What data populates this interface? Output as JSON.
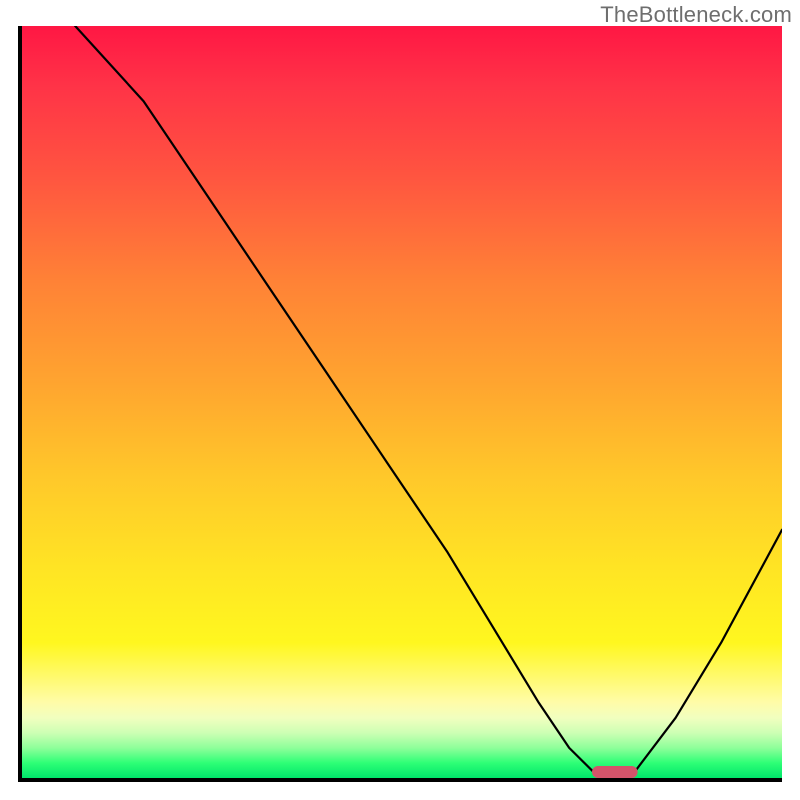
{
  "watermark": "TheBottleneck.com",
  "colors": {
    "gradient_top": "#ff1744",
    "gradient_bottom": "#00e56a",
    "curve": "#000000",
    "marker": "#d4546a",
    "axis": "#000000",
    "watermark_text": "#6e6e6e"
  },
  "chart_data": {
    "type": "line",
    "title": "",
    "xlabel": "",
    "ylabel": "",
    "xlim": [
      0,
      100
    ],
    "ylim": [
      0,
      100
    ],
    "grid": false,
    "legend": false,
    "series": [
      {
        "name": "bottleneck-curve",
        "x": [
          7,
          16,
          24,
          32,
          40,
          48,
          56,
          62,
          68,
          72,
          76,
          80,
          86,
          92,
          100
        ],
        "y": [
          100,
          90,
          78,
          66,
          54,
          42,
          30,
          20,
          10,
          4,
          0,
          0,
          8,
          18,
          33
        ]
      }
    ],
    "marker": {
      "name": "optimal-point",
      "x_center": 78,
      "y": 0.8,
      "rx_width": 6,
      "ry_height": 1.6
    }
  }
}
